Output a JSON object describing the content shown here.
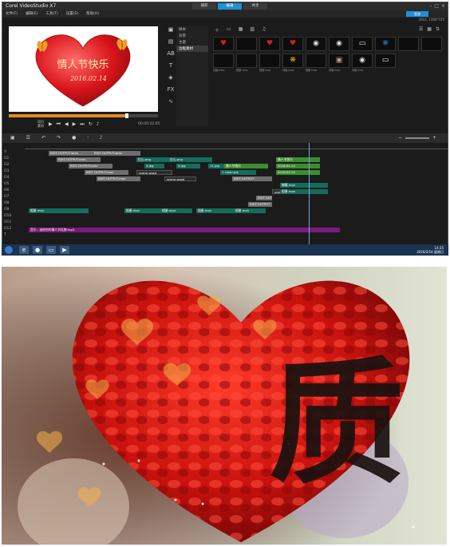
{
  "app": {
    "title": "Corel VideoStudio X7",
    "tabs": [
      "捕获",
      "编辑",
      "共享"
    ],
    "active_tab": "编辑",
    "menu": [
      "文件(F)",
      "编辑(E)",
      "工具(T)",
      "设置(S)",
      "帮助(H)"
    ],
    "signin_label": "登录",
    "project_info": "2016, 1280*720",
    "preview_title": "情人节快乐",
    "preview_date": "2016.02.14",
    "play_mode_labels": [
      "项目",
      "素材"
    ],
    "timecode": "00:00:22:05",
    "folders": [
      "样本",
      "背景",
      "主题",
      "边框素材"
    ],
    "selected_folder": "边框素材",
    "library_thumbs": [
      {
        "label": "",
        "icon": "heart"
      },
      {
        "label": "",
        "icon": "blank"
      },
      {
        "label": "",
        "icon": "heart-s"
      },
      {
        "label": "",
        "icon": "heart"
      },
      {
        "label": "",
        "icon": "disc"
      },
      {
        "label": "",
        "icon": "disc"
      },
      {
        "label": "",
        "icon": "white"
      },
      {
        "label": "",
        "icon": "butterfly-blue"
      },
      {
        "label": "",
        "icon": "blank"
      },
      {
        "label": "",
        "icon": "blank"
      },
      {
        "label": "动画.mov",
        "icon": "blank"
      },
      {
        "label": "相册.mov",
        "icon": "blank"
      },
      {
        "label": "相册.mov",
        "icon": "blank"
      },
      {
        "label": "动画.mov",
        "icon": "butterfly"
      },
      {
        "label": "相册.mov",
        "icon": "blank"
      },
      {
        "label": "动画.mov",
        "icon": "photo"
      },
      {
        "label": "动画.mov",
        "icon": "disc"
      },
      {
        "label": "",
        "icon": "white"
      }
    ],
    "timeline": {
      "track_heads": [
        "V",
        "O1",
        "O2",
        "O3",
        "O4",
        "O5",
        "O6",
        "O7",
        "O8",
        "O9",
        "O10",
        "O11",
        "O12",
        "T",
        "",
        "M"
      ],
      "clips": [
        {
          "label": "EDIT-OUTPUT.wmv",
          "kind": "gray"
        },
        {
          "label": "EDIT-OUTPUT.wmv",
          "kind": "gray"
        },
        {
          "label": "EDIT-OUTPUT.mov",
          "kind": "gray"
        },
        {
          "label": "EDIT-OUTPUT.mov",
          "kind": "gray"
        },
        {
          "label": "EDIT-OUTPUT.mov",
          "kind": "gray"
        },
        {
          "label": "EDIT-OUTPUT.mov",
          "kind": "gray"
        },
        {
          "label": "EDIT-OUTPUT",
          "kind": "gray"
        },
        {
          "label": "红心.png",
          "kind": "g"
        },
        {
          "label": "红心.png",
          "kind": "g"
        },
        {
          "label": "5.jpg",
          "kind": "g"
        },
        {
          "label": "5.jpg",
          "kind": "g"
        },
        {
          "label": "11.jpg",
          "kind": "g"
        },
        {
          "label": "情人节快乐",
          "kind": "lg"
        },
        {
          "label": "2016.02.14",
          "kind": "lg"
        },
        {
          "label": "2016.02.14",
          "kind": "lg"
        },
        {
          "label": "情人节快乐",
          "kind": "lg"
        },
        {
          "label": "1 clean.pia",
          "kind": "g"
        },
        {
          "label": "scene.wasd",
          "kind": "v"
        },
        {
          "label": "scene.wasd",
          "kind": "v"
        },
        {
          "label": "scene.wasd",
          "kind": "v"
        },
        {
          "label": "蝴蝶.mov",
          "kind": "g"
        },
        {
          "label": "相册.mov",
          "kind": "g"
        },
        {
          "label": "相册.mov",
          "kind": "g"
        },
        {
          "label": "相册.mov",
          "kind": "g"
        },
        {
          "label": "相册.mov",
          "kind": "g"
        },
        {
          "label": "相册.mov",
          "kind": "g"
        },
        {
          "label": "相册.mov",
          "kind": "g"
        },
        {
          "label": "EDIT-OUTPUT",
          "kind": "gray"
        },
        {
          "label": "EDIT-OUTPUT",
          "kind": "gray"
        },
        {
          "label": "音乐 - 送给你的情人节礼物.mp3",
          "kind": "p"
        }
      ]
    },
    "taskbar_time": "14:35",
    "taskbar_date": "2016/2/14 星期日"
  },
  "video_frame": {
    "character": "质",
    "heart_color": "#c0140f"
  }
}
